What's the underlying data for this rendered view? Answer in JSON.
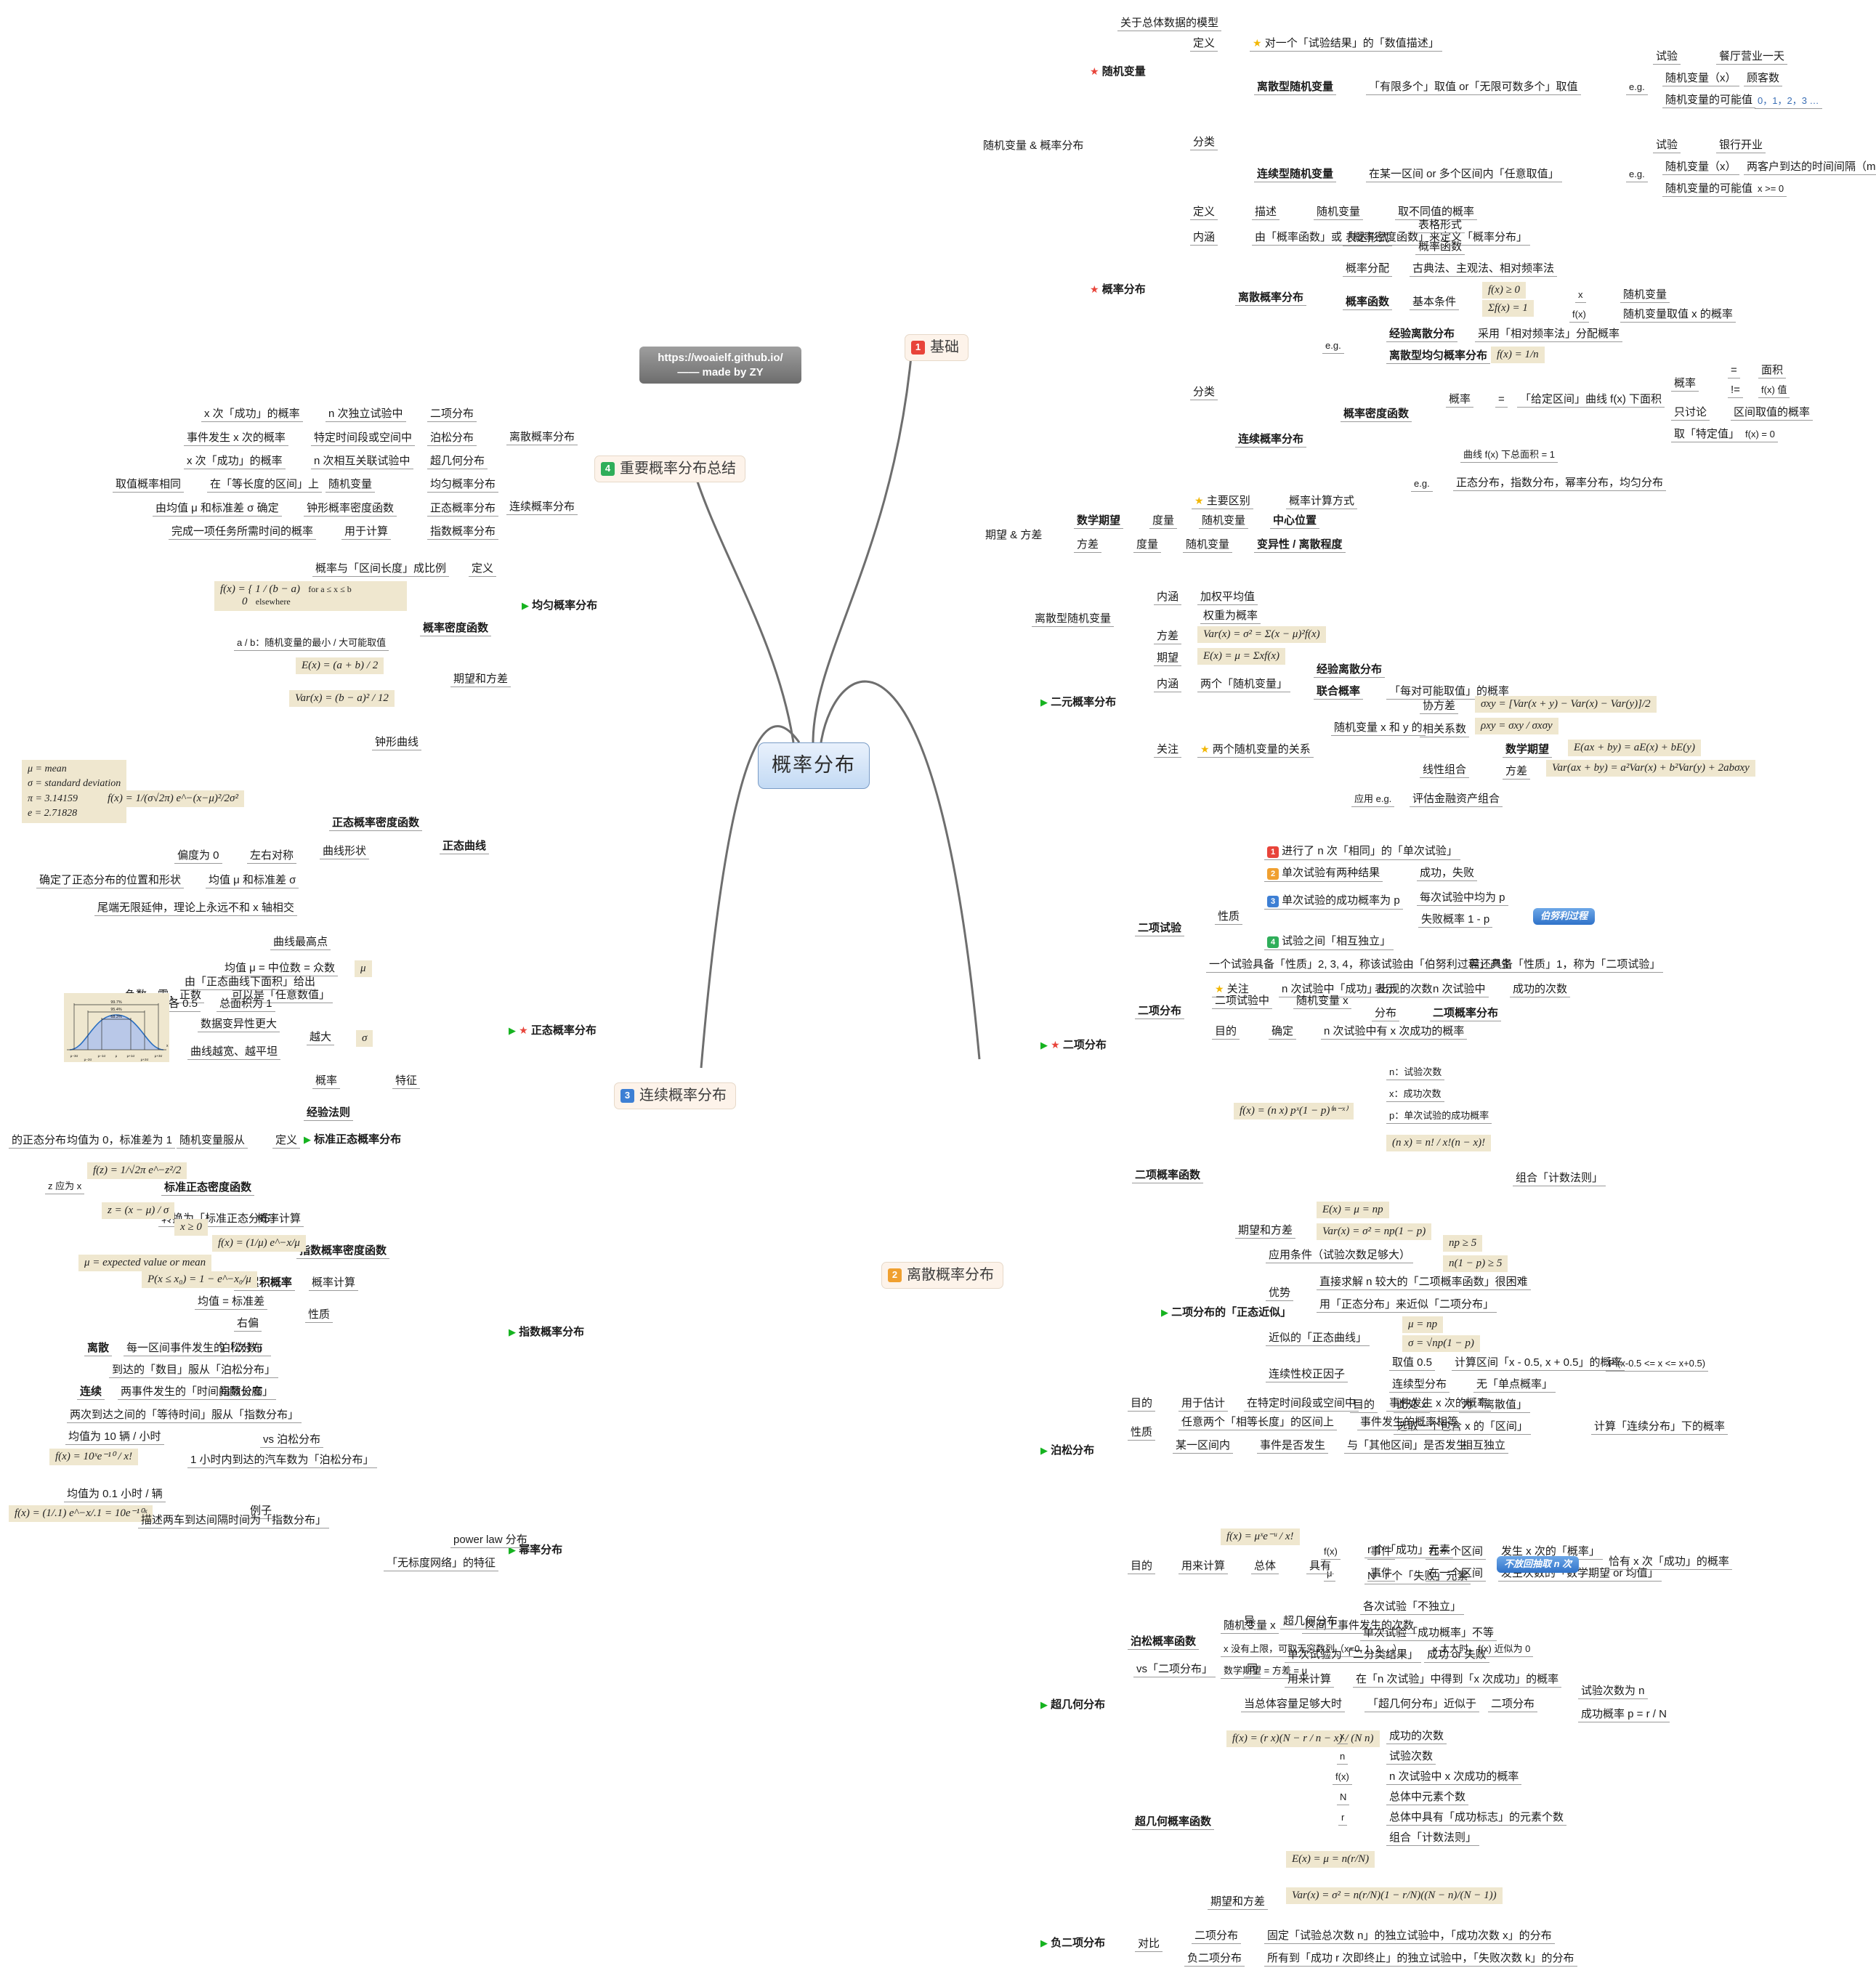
{
  "root": {
    "title": "概率分布"
  },
  "watermark": {
    "line1": "https://woaielf.github.io/",
    "line2": "—— made by ZY"
  },
  "branches": [
    {
      "num": "1",
      "label": "基础"
    },
    {
      "num": "2",
      "label": "离散概率分布"
    },
    {
      "num": "3",
      "label": "连续概率分布"
    },
    {
      "num": "4",
      "label": "重要概率分布总结"
    }
  ],
  "basics": {
    "group1": "随机变量 & 概率分布",
    "rv": {
      "title": "随机变量",
      "model": "关于总体数据的模型",
      "def_label": "定义",
      "def_value": "对一个「试验结果」的「数值描述」",
      "class_label": "分类",
      "discrete": {
        "name": "离散型随机变量",
        "desc": "「有限多个」取值 or「无限可数多个」取值",
        "eg": "e.g.",
        "rows": [
          {
            "k": "试验",
            "v": "餐厅营业一天"
          },
          {
            "k": "随机变量（x）",
            "v": "顾客数"
          },
          {
            "k": "随机变量的可能值",
            "v": "0，1，2，3 …"
          }
        ]
      },
      "continuous": {
        "name": "连续型随机变量",
        "desc": "在某一区间 or 多个区间内「任意取值」",
        "eg": "e.g.",
        "rows": [
          {
            "k": "试验",
            "v": "银行开业"
          },
          {
            "k": "随机变量（x）",
            "v": "两客户到达的时间间隔（min）"
          },
          {
            "k": "随机变量的可能值",
            "v": "x >= 0"
          }
        ]
      }
    },
    "pd": {
      "title": "概率分布",
      "def_label": "定义",
      "def_a": "描述",
      "def_b": "随机变量",
      "def_c": "取不同值的概率",
      "inner_label": "内涵",
      "inner_value": "由「概率函数」或「概率密度函数」来定义「概率分布」",
      "class_label": "分类",
      "discrete": {
        "name": "离散概率分布",
        "form_label": "表达形式",
        "form1": "表格形式",
        "form2": "概率函数",
        "alloc_label": "概率分配",
        "alloc_value": "古典法、主观法、相对频率法",
        "pf_label": "概率函数",
        "pf_cond": "基本条件",
        "pf_formula1": "f(x) ≥ 0",
        "pf_formula2": "Σf(x) = 1",
        "sym_x": "x",
        "sym_x_v": "随机变量",
        "sym_fx": "f(x)",
        "sym_fx_v": "随机变量取值 x 的概率",
        "eg": "e.g.",
        "eg1": "经验离散分布",
        "eg1_v": "采用「相对频率法」分配概率",
        "eg2": "离散型均匀概率分布",
        "eg2_f": "f(x) = 1/n"
      },
      "continuous": {
        "name": "连续概率分布",
        "pdf_label": "概率密度函数",
        "prob_label": "概率",
        "prob_eq": "=",
        "prob_value": "「给定区间」曲线 f(x) 下面积",
        "sub": [
          {
            "k": "概率",
            "op": "=",
            "v": "面积"
          },
          {
            "k": "",
            "op": "!=",
            "v": "f(x) 值"
          },
          {
            "k": "只讨论",
            "op": "",
            "v": "区间取值的概率"
          },
          {
            "k": "取「特定值」",
            "op": "",
            "v": "f(x) = 0"
          }
        ],
        "total_area": "曲线 f(x) 下总面积 = 1",
        "eg": "e.g.",
        "eg_value": "正态分布，指数分布，幂率分布，均匀分布"
      },
      "main_diff_label": "主要区别",
      "main_diff_value": "概率计算方式"
    },
    "ev": {
      "group": "期望 & 方差",
      "rows": [
        {
          "a": "数学期望",
          "b": "度量",
          "c": "随机变量",
          "d": "中心位置"
        },
        {
          "a": "方差",
          "b": "度量",
          "c": "随机变量",
          "d": "变异性 / 离散程度"
        }
      ]
    }
  },
  "discrete_dist": {
    "drv": {
      "title": "离散型随机变量",
      "inner_label": "内涵",
      "inner1": "加权平均值",
      "inner2": "权重为概率",
      "var_label": "方差",
      "var_f": "Var(x) = σ² = Σ(x − μ)²f(x)",
      "exp_label": "期望",
      "exp_f": "E(x) = μ = Σxf(x)"
    },
    "bivariate": {
      "title": "二元概率分布",
      "inner_label": "内涵",
      "inner_value": "两个「随机变量」",
      "empirical": "经验离散分布",
      "joint_label": "联合概率",
      "joint_value": "「每对可能取值」的概率",
      "focus_label": "关注",
      "focus_value": "两个随机变量的关系",
      "xy_label": "随机变量 x 和 y 的",
      "cov_label": "协方差",
      "cov_f": "σxy = [Var(x + y) − Var(x) − Var(y)]/2",
      "corr_label": "相关系数",
      "corr_f": "ρxy = σxy / σxσy",
      "lin_label": "线性组合",
      "lin_exp_label": "数学期望",
      "lin_exp_f": "E(ax + by) = aE(x) + bE(y)",
      "lin_var_label": "方差",
      "lin_var_f": "Var(ax + by) = a²Var(x) + b²Var(y) + 2abσxy",
      "app_label": "应用 e.g.",
      "app_value": "评估金融资产组合"
    },
    "binomial": {
      "title": "二项分布",
      "trial": {
        "title": "二项试验",
        "prop_label": "性质",
        "props": [
          {
            "n": "1",
            "t": "进行了 n 次「相同」的「单次试验」",
            "x": ""
          },
          {
            "n": "2",
            "t": "单次试验有两种结果",
            "x": "成功，失败"
          },
          {
            "n": "3",
            "t": "单次试验的成功概率为 p",
            "x": ""
          },
          {
            "n": "4",
            "t": "试验之间「相互独立」",
            "x": ""
          }
        ],
        "p3a": "每次试验中均为 p",
        "p3b": "失败概率 1 - p",
        "bubble": "伯努利过程",
        "rule": "一个试验具备「性质」2, 3, 4，称该试验由「伯努利过程」产生",
        "rule2": "若还具备「性质」1，称为「二项试验」",
        "focus_label": "关注",
        "focus_value": "n 次试验中「成功」出现的次数"
      },
      "dist": {
        "title": "二项分布",
        "row1a": "二项试验中",
        "row1b": "随机变量 x",
        "row1c": "表示",
        "row1d": "n 次试验中",
        "row1e": "成功的次数",
        "row2c": "分布",
        "row2d": "二项概率分布",
        "goal_label": "目的",
        "goal_a": "确定",
        "goal_b": "n 次试验中有 x 次成功的概率"
      },
      "pf": {
        "title": "二项概率函数",
        "formula": "f(x) = (n x) pˣ(1 − p)⁽ⁿ⁻ˣ⁾",
        "terms": [
          "n：试验次数",
          "x：成功次数",
          "p：单次试验的成功概率"
        ],
        "comb_f": "(n x) = n! / x!(n − x)!",
        "comb_label": "组合「计数法则」",
        "ev_label": "期望和方差",
        "exp_f": "E(x) = μ = np",
        "var_f": "Var(x) = σ² = np(1 − p)"
      },
      "normal_approx": {
        "title": "二项分布的「正态近似」",
        "cond_label": "应用条件（试验次数足够大）",
        "cond1": "np ≥ 5",
        "cond2": "n(1 − p) ≥ 5",
        "adv_label": "优势",
        "adv1": "直接求解 n 较大的「二项概率函数」很困难",
        "adv2": "用「正态分布」来近似「二项分布」",
        "approx_label": "近似的「正态曲线」",
        "approx_mu": "μ = np",
        "approx_sigma": "σ = √np(1 − p)",
        "corr_label": "连续性校正因子",
        "corr_take": "取值 0.5",
        "corr_calc_label": "计算区间「x - 0.5, x + 0.5」的概率",
        "corr_calc_v": "P (x-0.5 <= x <= x+0.5)",
        "goal_label": "目的",
        "goal1a": "连续型分布",
        "goal1b": "无「单点概率」",
        "goal2a": "此处 x",
        "goal2b": "为「离散值」",
        "goal3a": "选取一个包含 x 的「区间」",
        "goal3b": "计算「连续分布」下的概率"
      }
    },
    "poisson": {
      "title": "泊松分布",
      "goal_label": "目的",
      "goal_a": "用于估计",
      "goal_b": "在特定时间段或空间中",
      "goal_c": "事件发生 x 次的概率",
      "prop_label": "性质",
      "prop1a": "任意两个「相等长度」的区间上",
      "prop1b": "事件发生的概率相等",
      "prop2a": "某一区间内",
      "prop2b": "事件是否发生",
      "prop2c": "与「其他区间」是否发生",
      "prop2d": "相互独立",
      "pf_label": "泊松概率函数",
      "pf_formula": "f(x) = μˣe⁻ᵘ / x!",
      "sym_fx": "f(x)",
      "sym_fx_a": "事件",
      "sym_fx_b": "在一个区间",
      "sym_fx_c": "发生 x 次的「概率」",
      "sym_mu": "μ",
      "sym_mu_a": "事件",
      "sym_mu_b": "在一个区间",
      "sym_mu_c": "发生次数的「数学期望 or 均值」",
      "rv_label": "随机变量 x",
      "rv_value": "区间上事件发生的次数",
      "inf_a": "x 没有上限，可取无穷数列（x=0, 1, 2 …）",
      "inf_b": "x 太大时，f(x) 近似为 0",
      "ev": "数学期望 = 方差 = μ"
    },
    "hyper": {
      "title": "超几何分布",
      "goal_label": "目的",
      "goal_a": "用来计算",
      "goal_b": "总体",
      "goal_c": "具有",
      "goal_d1": "r 个「成功」元素",
      "goal_d2": "N - r 个「失败」元素",
      "bubble": "不放回抽取 n 次",
      "goal_e": "恰有 x 次「成功」的概率",
      "vs_label": "vs「二项分布」",
      "diff_label": "异",
      "diff_title": "超几何分布",
      "diff1": "各次试验「不独立」",
      "diff2": "单次试验「成功概率」不等",
      "same_label": "同",
      "same1a": "单次试验为「二分类结果」",
      "same1b": "成功 or 失败",
      "same2a": "用来计算",
      "same2b": "在「n 次试验」中得到「x 次成功」的概率",
      "big_a": "当总体容量足够大时",
      "big_b": "「超几何分布」近似于",
      "big_c": "二项分布",
      "big_d1": "试验次数为 n",
      "big_d2": "成功概率 p = r / N",
      "pf_label": "超几何概率函数",
      "pf_formula": "f(x) = (r x)(N − r / n − x) / (N n)",
      "terms": [
        {
          "k": "x",
          "v": "成功的次数"
        },
        {
          "k": "n",
          "v": "试验次数"
        },
        {
          "k": "f(x)",
          "v": "n 次试验中 x 次成功的概率"
        },
        {
          "k": "N",
          "v": "总体中元素个数"
        },
        {
          "k": "r",
          "v": "总体中具有「成功标志」的元素个数"
        },
        {
          "k": "",
          "v": "组合「计数法则」"
        }
      ],
      "ev_label": "期望和方差",
      "exp_f": "E(x) = μ = n(r/N)",
      "var_f": "Var(x) = σ² = n(r/N)(1 − r/N)((N − n)/(N − 1))"
    },
    "negbin": {
      "title": "负二项分布",
      "vs_label": "对比",
      "row1a": "二项分布",
      "row1b": "固定「试验总次数 n」的独立试验中，「成功次数 x」的分布",
      "row2a": "负二项分布",
      "row2b": "所有到「成功 r 次即终止」的独立试验中，「失败次数 k」的分布"
    }
  },
  "continuous_dist": {
    "uniform": {
      "title": "均匀概率分布",
      "def_label": "定义",
      "def_value": "概率与「区间长度」成比例",
      "pdf_label": "概率密度函数",
      "pdf_f1": "1 / (b − a)",
      "pdf_f1_cond": "for a ≤ x ≤ b",
      "pdf_f2": "0",
      "pdf_f2_cond": "elsewhere",
      "ab_note": "a / b：随机变量的最小 / 大可能取值",
      "ev_label": "期望和方差",
      "exp_f": "E(x) = (a + b) / 2",
      "var_f": "Var(x) = (b − a)² / 12"
    },
    "normal": {
      "title": "正态概率分布",
      "curve_title": "正态曲线",
      "bell": "钟形曲线",
      "pdf_label": "正态概率密度函数",
      "consts": [
        "μ = mean",
        "σ = standard deviation",
        "π = 3.14159",
        "e = 2.71828"
      ],
      "pdf_f": "f(x) = 1/(σ√2π) e^−(x−μ)²/2σ²",
      "shape_label": "曲线形状",
      "shape1a": "偏度为 0",
      "shape1b": "左右对称",
      "shape2a": "确定了正态分布的位置和形状",
      "shape2b": "均值 μ 和标准差 σ",
      "shape3": "尾端无限延伸，理论上永远不和 x 轴相交",
      "feat_label": "特征",
      "mu_label": "μ",
      "mu1": "曲线最高点",
      "mu2": "均值 μ = 中位数 = 众数",
      "mu3a": "负数，零，正数",
      "mu3b": "可以是「任意数值」",
      "sigma_label": "σ",
      "sigma_bigger": "越大",
      "sig1": "数据变异性更大",
      "sig2": "曲线越宽、越平坦",
      "prob_label": "概率",
      "prob1": "由「正态曲线下面积」给出",
      "prob2a": "左右各 0.5",
      "prob2b": "总面积为 1",
      "empirical_label": "经验法则",
      "chart": {
        "r1": "99.7%",
        "r2": "95.4%",
        "r3": "68.3%",
        "ticks": [
          "μ−3σ",
          "μ−2σ",
          "μ−1σ",
          "μ",
          "μ+1σ",
          "μ+2σ",
          "μ+3σ"
        ],
        "xaxis": "x"
      },
      "std": {
        "title": "标准正态概率分布",
        "def_label": "定义",
        "def_a": "随机变量服从",
        "def_b": "均值为 0，标准差为 1",
        "def_c": "的正态分布",
        "pdf_label": "标准正态密度函数",
        "pdf_f": "f(z) = 1/√2π e^−z²/2",
        "z_note": "z 应为 x",
        "calc_label": "概率计算",
        "calc_value": "转换为「标准正态分布」",
        "z_f": "z = (x − μ) / σ"
      }
    },
    "exponential": {
      "title": "指数概率分布",
      "pdf_label": "指数概率密度函数",
      "pdf_f": "f(x) = (1/μ) e^−x/μ",
      "cond": "x ≥ 0",
      "mu_note": "μ = expected value or mean",
      "cum_label": "累积概率",
      "cum_f": "P(x ≤ x₀) = 1 − e^−x₀/μ",
      "calc_label": "概率计算",
      "prop_label": "性质",
      "prop1": "均值 = 标准差",
      "prop2": "右偏",
      "vs_label": "vs 泊松分布",
      "vs1a": "离散",
      "vs1b": "每一区间事件发生的「次数」",
      "vs1c": "到达的「数目」服从「泊松分布」",
      "vs1_tag": "泊松分布",
      "vs2a": "连续",
      "vs2b": "两事件发生的「时间间隔长度」",
      "vs2c": "两次到达之间的「等待时间」服从「指数分布」",
      "vs2_tag": "指数分布",
      "ex_label": "例子",
      "ex1_mean": "均值为 10 辆 / 小时",
      "ex1_f": "f(x) = 10ˣe⁻¹⁰ / x!",
      "ex1_desc": "1 小时内到达的汽车数为「泊松分布」",
      "ex2_mean": "均值为 0.1 小时 / 辆",
      "ex2_f": "f(x) = (1/.1) e^−x/.1 = 10e⁻¹⁰ˣ",
      "ex2_desc": "描述两车到达间隔时间为「指数分布」"
    },
    "power": {
      "title": "幂率分布",
      "a": "power law 分布",
      "b": "「无标度网络」的特征"
    }
  },
  "summary": {
    "title": "重要概率分布总结",
    "discrete_label": "离散概率分布",
    "continuous_label": "连续概率分布",
    "rows": [
      {
        "a": "x 次「成功」的概率",
        "b": "n 次独立试验中",
        "c": "二项分布"
      },
      {
        "a": "事件发生 x 次的概率",
        "b": "特定时间段或空间中",
        "c": "泊松分布"
      },
      {
        "a": "x 次「成功」的概率",
        "b": "n 次相互关联试验中",
        "c": "超几何分布"
      },
      {
        "a": "取值概率相同",
        "b": "在「等长度的区间」上",
        "c": "随机变量",
        "d": "均匀概率分布"
      },
      {
        "a": "由均值 μ 和标准差 σ 确定",
        "b": "钟形概率密度函数",
        "c": "正态概率分布"
      },
      {
        "a": "完成一项任务所需时间的概率",
        "b": "用于计算",
        "c": "指数概率分布"
      }
    ]
  }
}
